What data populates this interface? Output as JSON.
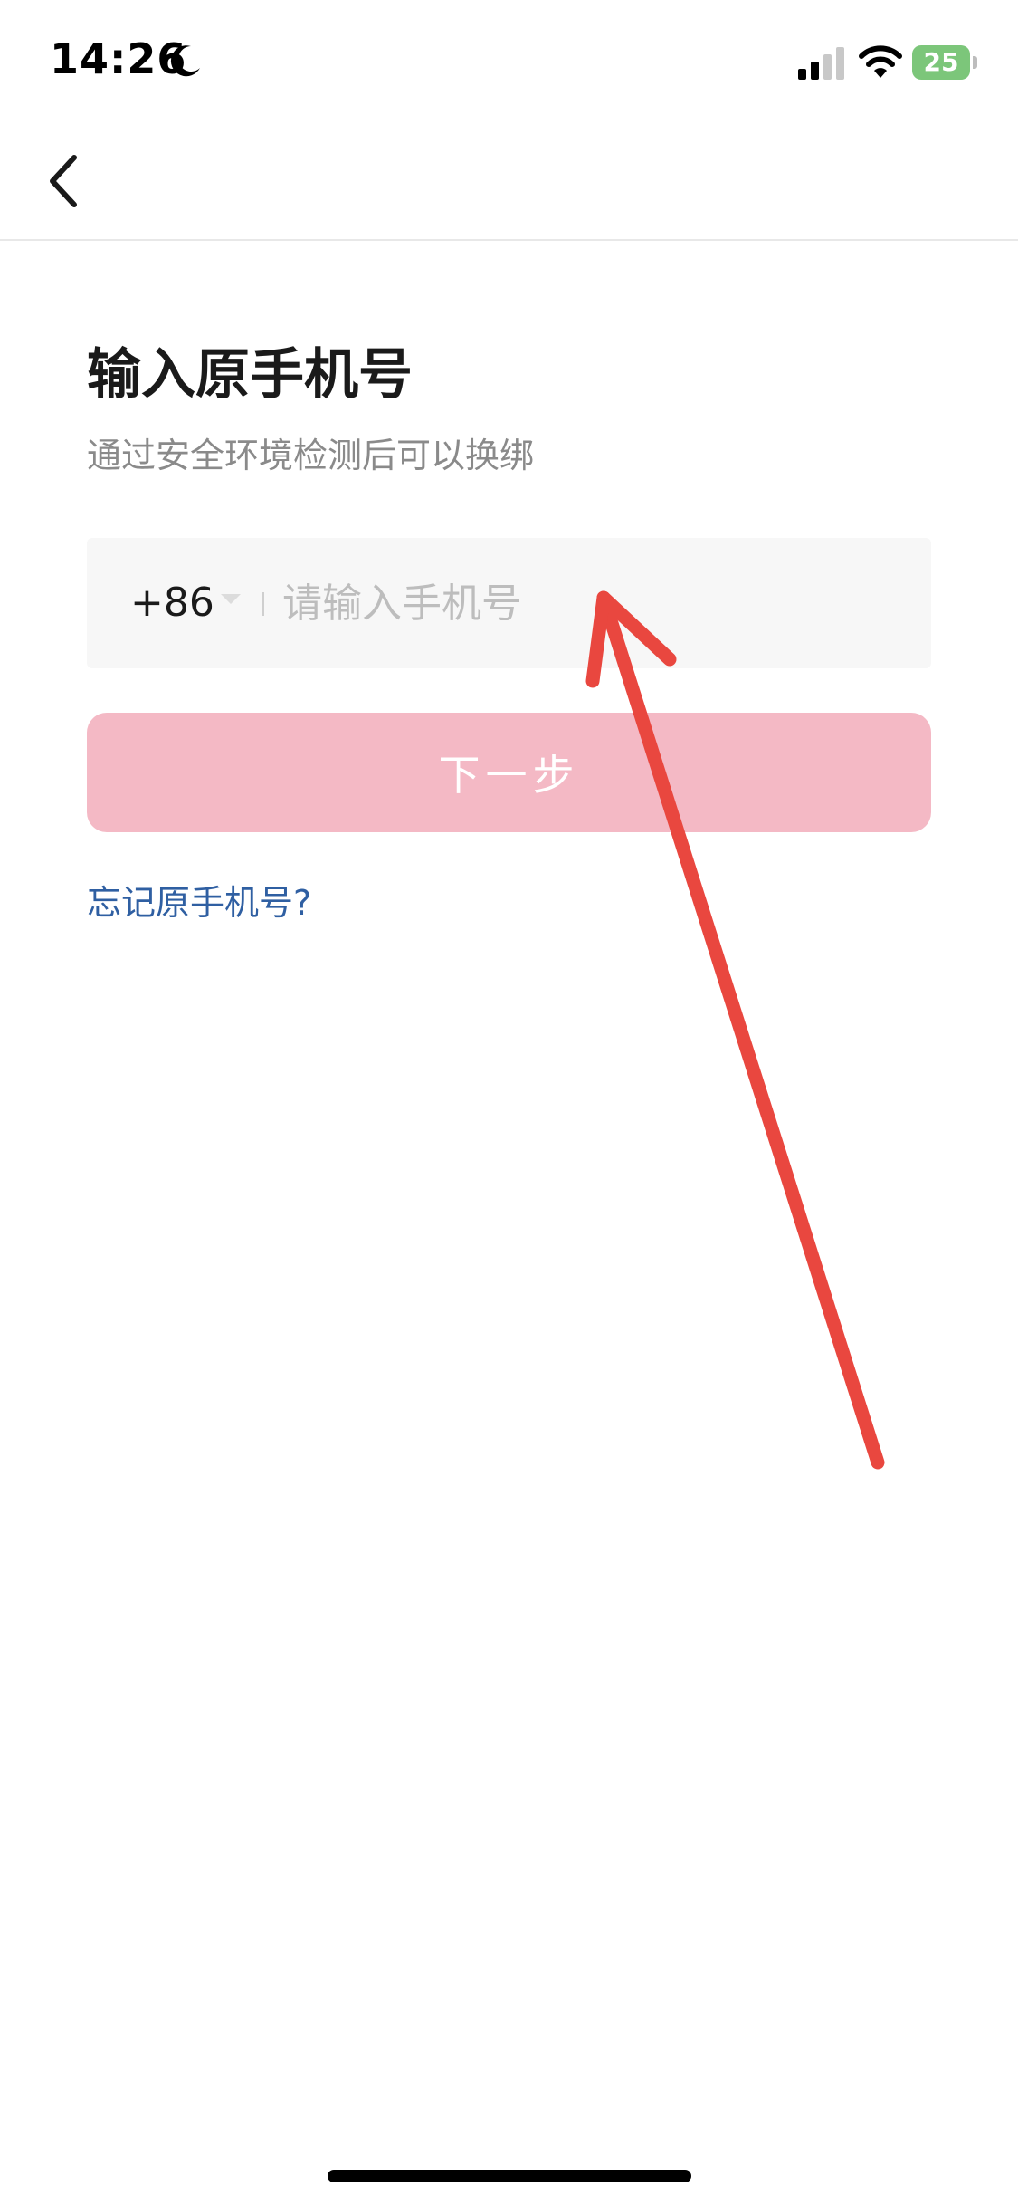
{
  "status_bar": {
    "time": "14:26",
    "battery_level": "25",
    "battery_color": "#7cc67a",
    "icons": [
      "moon-icon",
      "signal-icon",
      "wifi-icon",
      "battery-charging-icon"
    ]
  },
  "nav": {
    "back_icon": "chevron-left-icon"
  },
  "page": {
    "title": "输入原手机号",
    "subtitle": "通过安全环境检测后可以换绑"
  },
  "phone_input": {
    "country_code": "+86",
    "placeholder": "请输入手机号",
    "value": ""
  },
  "next_button": {
    "label": "下一步",
    "color": "#f4b9c5"
  },
  "forgot_link": {
    "label": "忘记原手机号?",
    "color": "#2f5fa2"
  },
  "annotation": {
    "type": "red-arrow",
    "color": "#e9473f"
  }
}
